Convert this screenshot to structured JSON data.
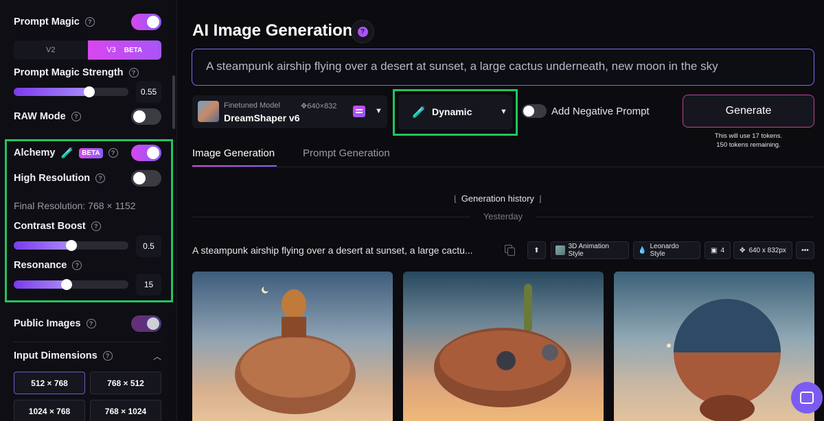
{
  "sidebar": {
    "prompt_magic": {
      "label": "Prompt Magic",
      "on": true
    },
    "versions": {
      "v2": "V2",
      "v3": "V3",
      "v3_badge": "BETA"
    },
    "prompt_magic_strength": {
      "label": "Prompt Magic Strength",
      "value": "0.55",
      "level": 0.66
    },
    "raw_mode": {
      "label": "RAW Mode",
      "on": false
    },
    "alchemy": {
      "label": "Alchemy",
      "badge": "BETA",
      "on": true
    },
    "high_resolution": {
      "label": "High Resolution",
      "on": false
    },
    "final_resolution": "Final Resolution: 768 × 1152",
    "contrast_boost": {
      "label": "Contrast Boost",
      "value": "0.5",
      "level": 0.5
    },
    "resonance": {
      "label": "Resonance",
      "value": "15",
      "level": 0.46
    },
    "public_images": {
      "label": "Public Images",
      "on": true
    },
    "input_dimensions": {
      "label": "Input Dimensions",
      "options": [
        "512 × 768",
        "768 × 512",
        "1024 × 768",
        "768 × 1024"
      ],
      "selected": "512 × 768"
    }
  },
  "main": {
    "title": "AI Image Generation",
    "help_symbol": "?",
    "prompt": "A steampunk airship flying over a desert at sunset, a large cactus underneath, new moon in the sky",
    "model": {
      "sub": "Finetuned Model",
      "size": "640×832",
      "name": "DreamShaper v6"
    },
    "preset": "Dynamic",
    "negative_prompt_label": "Add Negative Prompt",
    "generate_label": "Generate",
    "tokens_line1": "This will use 17 tokens.",
    "tokens_line2": "150 tokens remaining.",
    "tabs": [
      "Image Generation",
      "Prompt Generation"
    ],
    "active_tab": "Image Generation",
    "history_title": "Generation history",
    "yesterday": "Yesterday",
    "item": {
      "prompt": "A steampunk airship flying over a desert at sunset, a large cactu...",
      "chips": [
        "3D Animation Style",
        "Leonardo Style",
        "4",
        "640 x 832px"
      ],
      "more": "•••"
    }
  },
  "colors": {
    "accent": "#a855f7",
    "highlight_box": "#22c55e",
    "gradient_start": "#d946ef",
    "gradient_end": "#8b5cf6"
  },
  "icons": [
    "help-icon",
    "flask-icon",
    "caret-down-icon",
    "copy-icon",
    "upload-icon",
    "droplet-icon",
    "images-icon",
    "move-icon",
    "more-icon",
    "chat-icon",
    "chevron-up-icon"
  ]
}
